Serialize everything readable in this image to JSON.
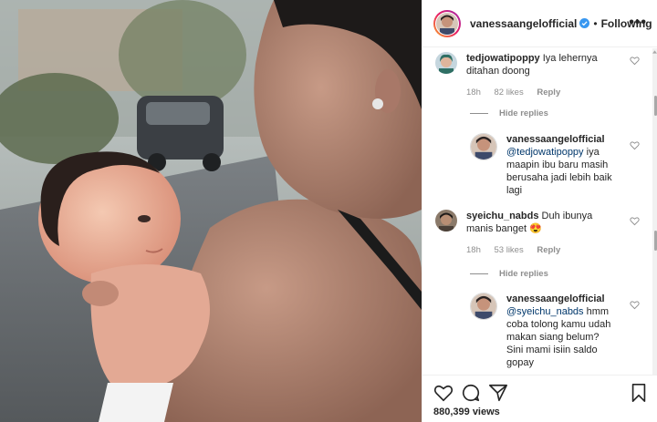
{
  "post": {
    "username": "vanessaangelofficial",
    "dot": "•",
    "follow_label": "Following",
    "more_label": "•••",
    "views_text": "880,399 views"
  },
  "comments": [
    {
      "username": "tedjowatipoppy",
      "text": "Iya lehernya ditahan doong",
      "time": "18h",
      "likes": "82 likes",
      "reply_label": "Reply",
      "hide_replies_label": "Hide replies",
      "reply": {
        "username": "vanessaangelofficial",
        "mention": "@tedjowatipoppy",
        "text": "iya maapin ibu baru masih berusaha jadi lebih baik lagi"
      }
    },
    {
      "username": "syeichu_nabds",
      "text": "Duh ibunya manis banget 😍",
      "time": "18h",
      "likes": "53 likes",
      "reply_label": "Reply",
      "hide_replies_label": "Hide replies",
      "reply": {
        "username": "vanessaangelofficial",
        "mention": "@syeichu_nabds",
        "text": "hmm coba tolong kamu udah makan siang belum? Sini mami isiin saldo gopay"
      }
    }
  ],
  "icons": {
    "heart": "heart-icon",
    "comment": "comment-icon",
    "share": "share-icon",
    "save": "bookmark-icon",
    "verified": "verified-badge-icon",
    "more": "more-options-icon"
  },
  "colors": {
    "verified_blue": "#3897f0",
    "text": "#262626",
    "muted": "#8e8e8e",
    "mention": "#00376b"
  }
}
